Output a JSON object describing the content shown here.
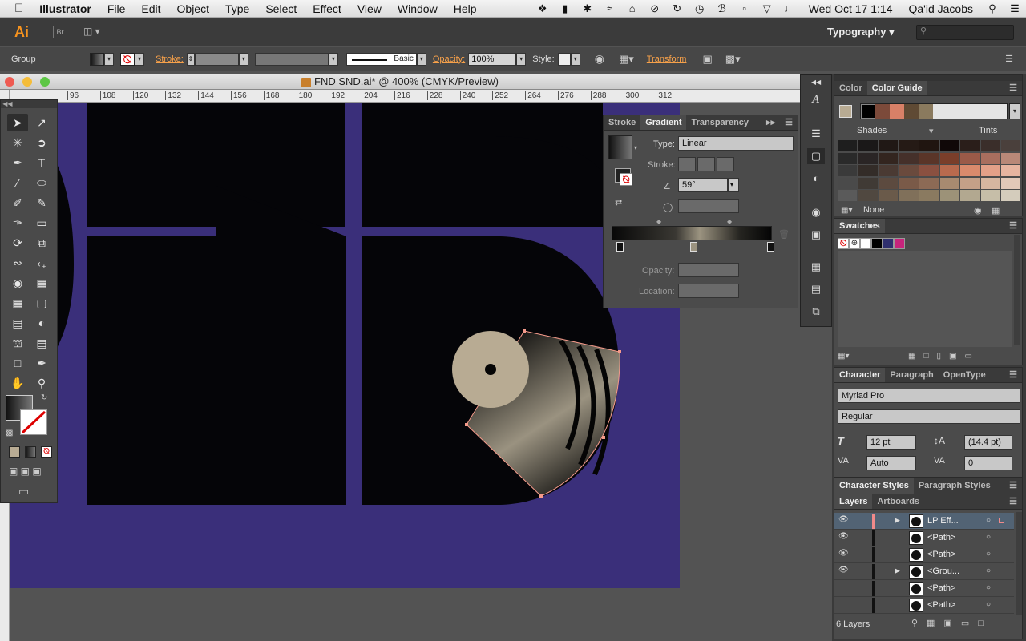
{
  "menubar": {
    "items": [
      "Illustrator",
      "File",
      "Edit",
      "Object",
      "Type",
      "Select",
      "Effect",
      "View",
      "Window",
      "Help"
    ],
    "clock": "Wed Oct 17  1:14",
    "user": "Qa'id Jacobs"
  },
  "appbar": {
    "logo": "Ai",
    "bridge": "Br",
    "workspace": "Typography",
    "search_placeholder": ""
  },
  "control": {
    "selection": "Group",
    "stroke_label": "Stroke:",
    "brush_label": "Basic",
    "opacity_label": "Opacity:",
    "opacity_value": "100%",
    "style_label": "Style:",
    "transform_label": "Transform"
  },
  "document": {
    "title": "FND SND.ai* @ 400% (CMYK/Preview)",
    "ruler_ticks": [
      "96",
      "108",
      "120",
      "132",
      "144",
      "156",
      "168",
      "180",
      "192",
      "204",
      "216",
      "228",
      "240",
      "252",
      "264",
      "276",
      "288",
      "300",
      "312"
    ]
  },
  "gradient_panel": {
    "tabs": [
      "Stroke",
      "Gradient",
      "Transparency"
    ],
    "type_label": "Type:",
    "type_value": "Linear",
    "stroke_label": "Stroke:",
    "angle_value": "59°",
    "opacity_label": "Opacity:",
    "location_label": "Location:"
  },
  "color_panel": {
    "tabs": [
      "Color",
      "Color Guide"
    ],
    "shades_label": "Shades",
    "tints_label": "Tints",
    "none_label": "None"
  },
  "swatches_panel": {
    "title": "Swatches"
  },
  "character_panel": {
    "tabs": [
      "Character",
      "Paragraph",
      "OpenType"
    ],
    "font": "Myriad Pro",
    "style": "Regular",
    "size": "12 pt",
    "leading": "(14.4 pt)",
    "kerning": "Auto",
    "tracking": "0"
  },
  "styles_panel": {
    "tabs": [
      "Character Styles",
      "Paragraph Styles"
    ]
  },
  "layers_panel": {
    "tabs": [
      "Layers",
      "Artboards"
    ],
    "rows": [
      "LP Eff...",
      "<Path>",
      "<Path>",
      "<Grou...",
      "<Path>",
      "<Path>"
    ],
    "count": "6 Layers"
  },
  "colors": {
    "artboard_bg": "#3f2f7e",
    "accent": "#f7931e",
    "record_label": "#b8ab93"
  }
}
